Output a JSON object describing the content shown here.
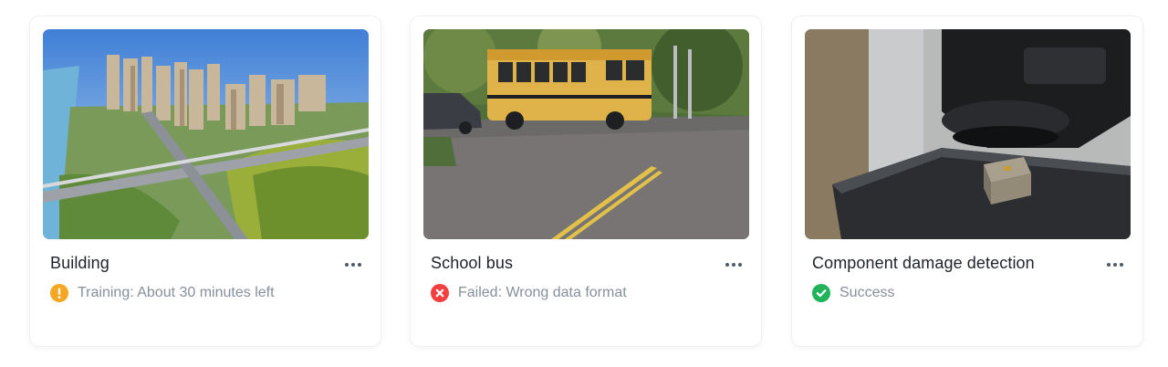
{
  "cards": [
    {
      "title": "Building",
      "status_text": "Training: About 30 minutes left",
      "status": "training",
      "status_icon": "warning-icon",
      "status_color": "#f5a623",
      "image": "aerial-city-image"
    },
    {
      "title": "School bus",
      "status_text": "Failed: Wrong data format",
      "status": "failed",
      "status_icon": "error-icon",
      "status_color": "#f53f3f",
      "image": "school-bus-image"
    },
    {
      "title": "Component damage detection",
      "status_text": "Success",
      "status": "success",
      "status_icon": "check-icon",
      "status_color": "#21b35c",
      "image": "microscope-component-image"
    }
  ],
  "colors": {
    "title": "#1f2329",
    "status_text": "#86909c",
    "card_border": "#eef0f3"
  }
}
